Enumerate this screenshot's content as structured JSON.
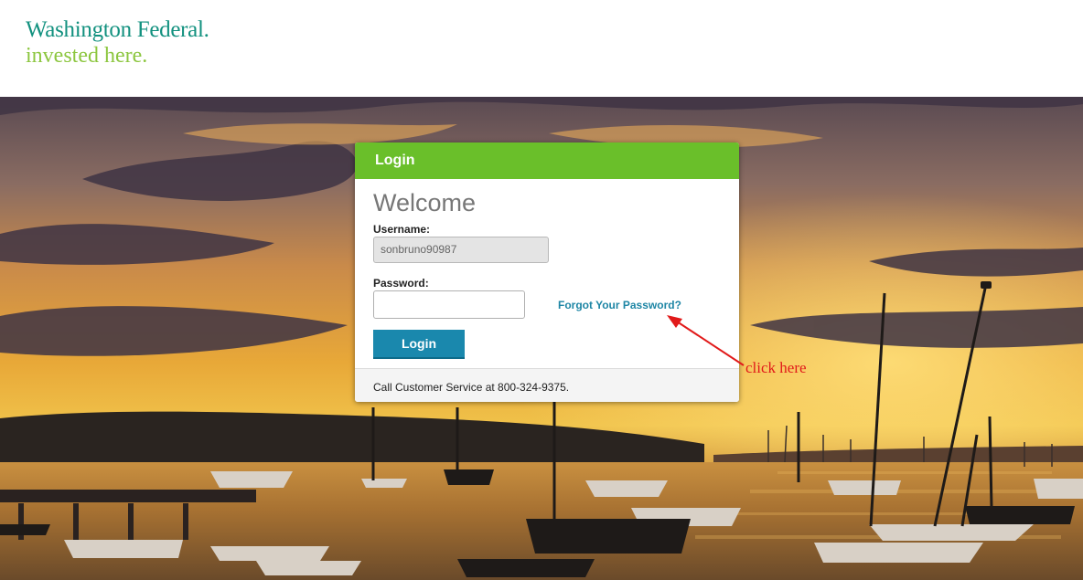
{
  "brand": {
    "name": "Washington Federal.",
    "tagline": "invested here.",
    "name_color": "#12917f",
    "tagline_color": "#8cc63f"
  },
  "hero": {
    "description_icon": "harbor-sunset-photo"
  },
  "login": {
    "header": "Login",
    "welcome": "Welcome",
    "username_label": "Username:",
    "username_value": "sonbruno90987",
    "password_label": "Password:",
    "password_value": "",
    "forgot_link": "Forgot Your Password?",
    "submit_label": "Login",
    "footer_text": "Call Customer Service at 800-324-9375.",
    "header_color": "#6abf2a",
    "button_color": "#1a88ad",
    "link_color": "#1e86a5"
  },
  "annotation": {
    "text": "click here",
    "color": "#e11a1a",
    "icon": "red-arrow-icon"
  }
}
